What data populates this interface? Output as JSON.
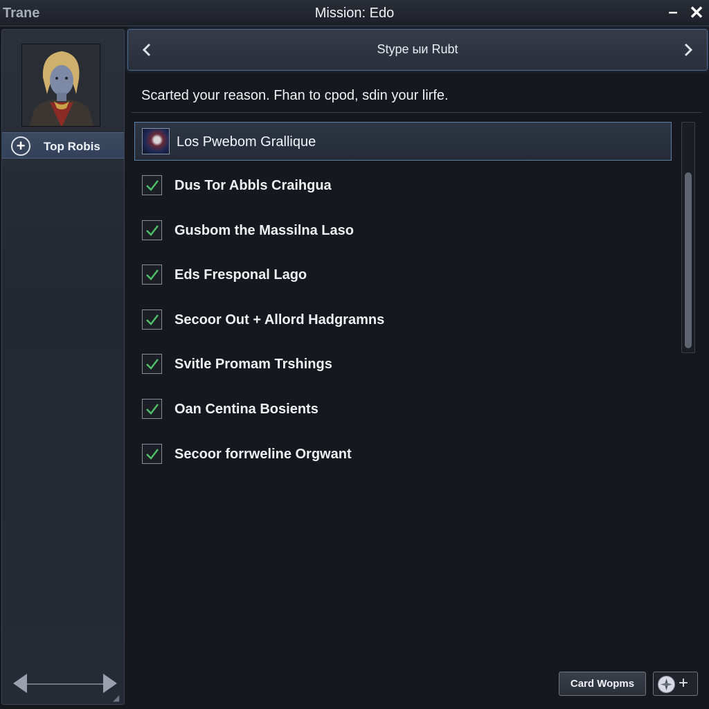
{
  "titlebar": {
    "app_name": "Trane",
    "window_title": "Mission: Edo",
    "minimize_label": "–",
    "close_label": "✕"
  },
  "sidebar": {
    "items": [
      {
        "label": "Top Robis",
        "icon": "plus-circle-icon"
      }
    ]
  },
  "header": {
    "title": "Stype ыи Rubt",
    "prev_icon": "chevron-left-icon",
    "next_icon": "chevron-right-icon"
  },
  "main": {
    "prompt": "Scarted your reason. Fhan to cpod, sdin your lirfe.",
    "selected_item": {
      "label": "Los Pwebom Grallique"
    },
    "list": [
      {
        "label": "Dus Tor Abbls Craihgua",
        "checked": true
      },
      {
        "label": "Gusbom the Massilna Laso",
        "checked": true
      },
      {
        "label": "Eds Fresponal Lago",
        "checked": true
      },
      {
        "label": "Secoor Out + Allord Hadgramns",
        "checked": true
      },
      {
        "label": "Svitle Promam Trshings",
        "checked": true
      },
      {
        "label": "Oan Centina Bosients",
        "checked": true
      },
      {
        "label": "Secoor forrweline Orgwant",
        "checked": true
      }
    ]
  },
  "footer": {
    "card_button": "Card Wopms",
    "add_label": "+"
  },
  "colors": {
    "background": "#16181d",
    "accent": "#5b7fa6",
    "check": "#4fbf6a"
  }
}
